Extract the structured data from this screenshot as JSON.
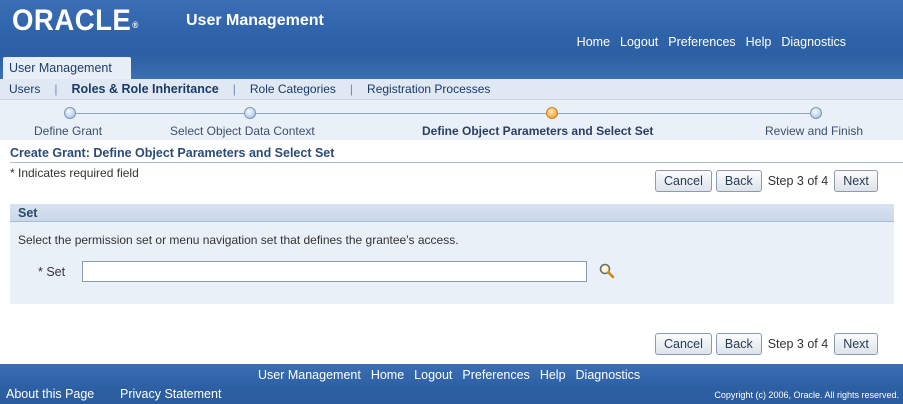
{
  "header": {
    "logo": "ORACLE",
    "logo_mark": "®",
    "app_title": "User Management",
    "global_links": [
      "Home",
      "Logout",
      "Preferences",
      "Help",
      "Diagnostics"
    ],
    "tab": "User Management"
  },
  "subtabs": {
    "items": [
      "Users",
      "Roles & Role Inheritance",
      "Role Categories",
      "Registration Processes"
    ],
    "active": "Roles & Role Inheritance"
  },
  "train": {
    "steps": [
      "Define Grant",
      "Select Object Data Context",
      "Define Object Parameters and Select Set",
      "Review and Finish"
    ],
    "current_index": 2
  },
  "page": {
    "title": "Create Grant: Define Object Parameters and Select Set",
    "required_note": "* Indicates required field"
  },
  "buttons": {
    "cancel": "Cancel",
    "back": "Back",
    "step_of": "Step 3 of 4",
    "next": "Next"
  },
  "set_section": {
    "heading": "Set",
    "instruction": "Select the permission set or menu navigation set that defines the grantee's access.",
    "label": "* Set",
    "value": "",
    "search_icon": "search-icon"
  },
  "footer": {
    "links": [
      "User Management",
      "Home",
      "Logout",
      "Preferences",
      "Help",
      "Diagnostics"
    ],
    "about": "About this Page",
    "privacy": "Privacy Statement",
    "copyright": "Copyright (c) 2006, Oracle. All rights reserved."
  },
  "colors": {
    "header_blue": "#2f63a9",
    "train_current": "#f7b152",
    "panel_bg": "#eaf0f8"
  }
}
